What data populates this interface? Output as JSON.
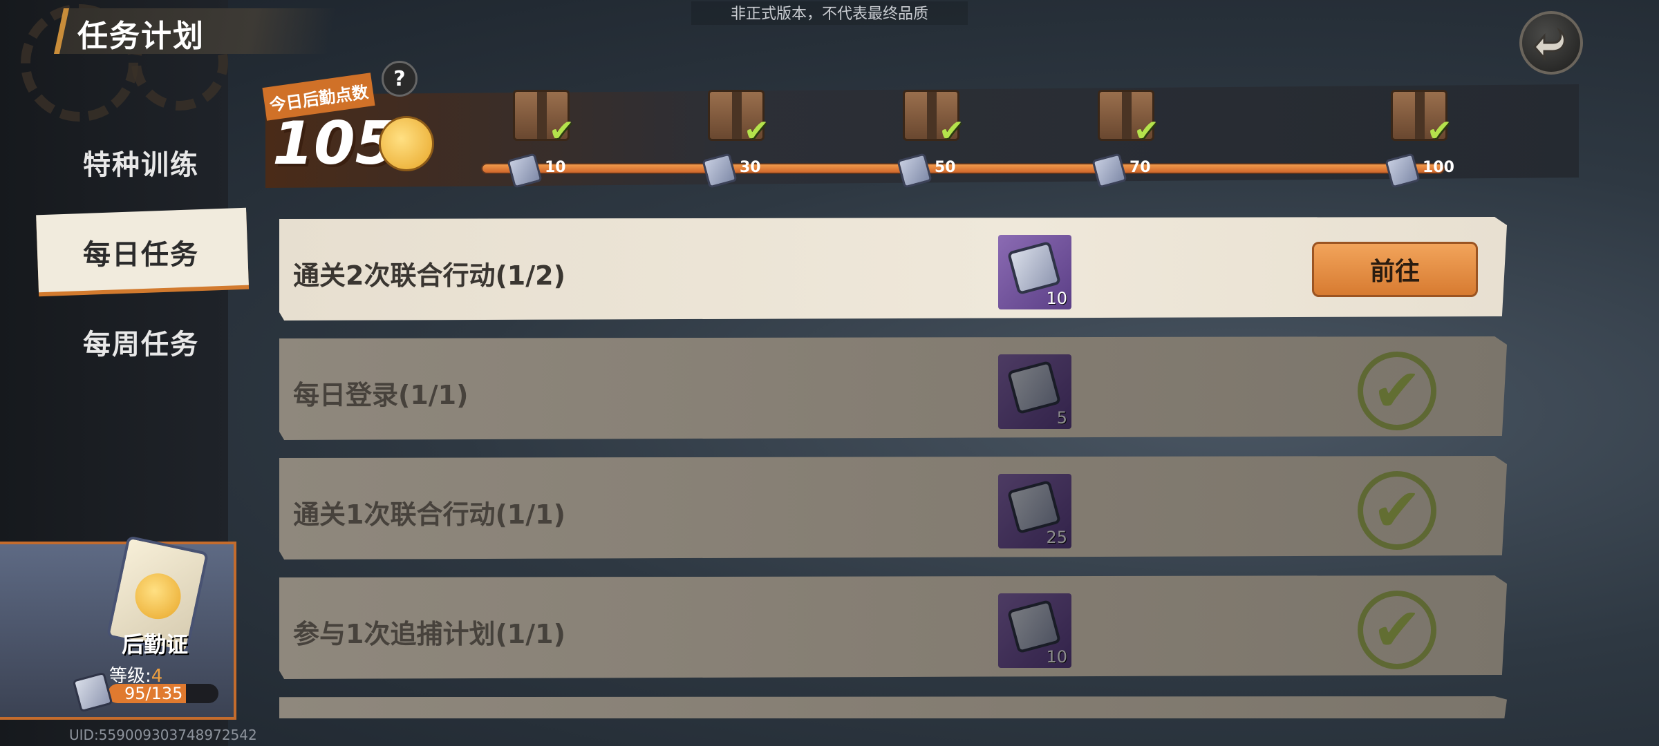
{
  "watermark": "非正式版本，不代表最终品质",
  "title": "任务计划",
  "points": {
    "label": "今日后勤点数",
    "value": "105",
    "progress": 1.0
  },
  "milestones": [
    {
      "label": "10",
      "claimed": true
    },
    {
      "label": "30",
      "claimed": true
    },
    {
      "label": "50",
      "claimed": true
    },
    {
      "label": "70",
      "claimed": true
    },
    {
      "label": "100",
      "claimed": true
    }
  ],
  "nav": {
    "items": [
      {
        "label": "特种训练",
        "active": false
      },
      {
        "label": "每日任务",
        "active": true
      },
      {
        "label": "每周任务",
        "active": false
      }
    ]
  },
  "tasks": [
    {
      "text": "通关2次联合行动(1/2)",
      "reward": "10",
      "status": "go",
      "button": "前往"
    },
    {
      "text": "每日登录(1/1)",
      "reward": "5",
      "status": "done"
    },
    {
      "text": "通关1次联合行动(1/1)",
      "reward": "25",
      "status": "done"
    },
    {
      "text": "参与1次追捕计划(1/1)",
      "reward": "10",
      "status": "done"
    }
  ],
  "card": {
    "title": "后勤证",
    "level_label": "等级:",
    "level": "4",
    "exp": "95/135",
    "exp_fraction": 0.7037
  },
  "uid": "UID:559009303748972542",
  "icons": {
    "back": "back-arrow-icon",
    "help": "question-icon",
    "chest": "supply-chest-icon",
    "ticket": "logistics-ticket-icon",
    "check": "checkmark-icon"
  },
  "colors": {
    "accent_orange": "#d87a30",
    "active_row": "#ece4d5",
    "done_row": "#878075",
    "check_green": "#b4e34c"
  }
}
